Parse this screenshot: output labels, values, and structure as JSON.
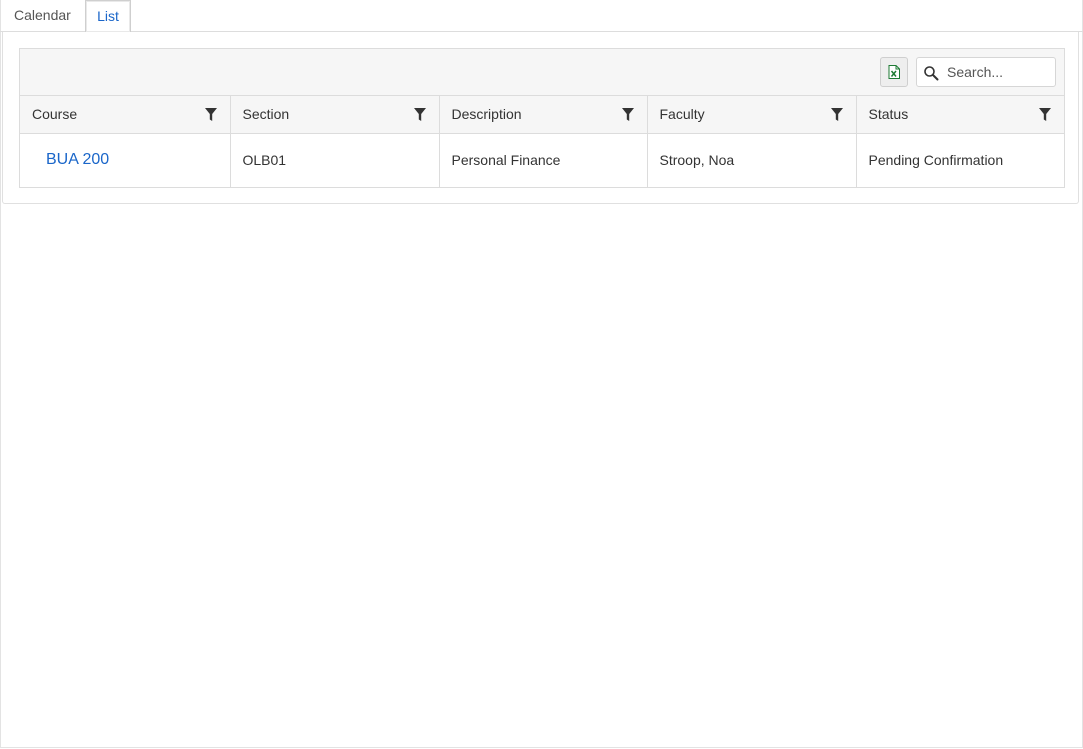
{
  "tabs": [
    {
      "label": "Calendar",
      "active": false
    },
    {
      "label": "List",
      "active": true
    }
  ],
  "toolbar": {
    "export_icon": "excel-export-icon",
    "search_placeholder": "Search...",
    "search_value": ""
  },
  "table": {
    "columns": [
      "Course",
      "Section",
      "Description",
      "Faculty",
      "Status"
    ],
    "rows": [
      {
        "course": "BUA 200",
        "section": "OLB01",
        "description": "Personal Finance",
        "faculty": "Stroop, Noa",
        "status": "Pending Confirmation"
      }
    ]
  },
  "colors": {
    "accent": "#1a66c9",
    "excel_green": "#1e7b34",
    "header_bg": "#f6f6f6",
    "border": "#dcdcdc"
  }
}
